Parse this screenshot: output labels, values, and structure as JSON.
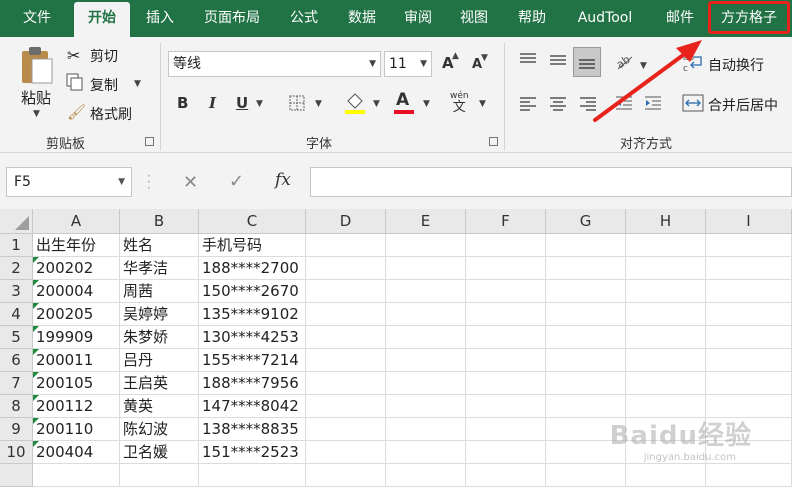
{
  "tabs": [
    "文件",
    "开始",
    "插入",
    "页面布局",
    "公式",
    "数据",
    "审阅",
    "视图",
    "帮助",
    "AudTool",
    "邮件",
    "方方格子"
  ],
  "active_tab": "开始",
  "clipboard": {
    "paste": "粘贴",
    "cut": "剪切",
    "copy": "复制",
    "format_painter": "格式刷",
    "group": "剪贴板"
  },
  "font": {
    "name": "等线",
    "size": "11",
    "bold": "B",
    "italic": "I",
    "underline": "U",
    "font_color": "A",
    "group": "字体",
    "fill_color": "#ffff00",
    "text_color": "#e81123",
    "grow": "A",
    "shrink": "A",
    "phonetic_top": "wén",
    "phonetic_bottom": "文"
  },
  "alignment": {
    "wrap": "自动换行",
    "merge": "合并后居中",
    "group": "对齐方式"
  },
  "formula": {
    "namebox": "F5",
    "fx": "fx",
    "value": ""
  },
  "columns": [
    "A",
    "B",
    "C",
    "D",
    "E",
    "F",
    "G",
    "H",
    "I"
  ],
  "rows": [
    {
      "num": "1",
      "a": "出生年份",
      "b": "姓名",
      "c": "手机号码",
      "flag": false
    },
    {
      "num": "2",
      "a": "200202",
      "b": "华孝洁",
      "c": "188****2700",
      "flag": true
    },
    {
      "num": "3",
      "a": "200004",
      "b": "周茜",
      "c": "150****2670",
      "flag": true
    },
    {
      "num": "4",
      "a": "200205",
      "b": "吴婷婷",
      "c": "135****9102",
      "flag": true
    },
    {
      "num": "5",
      "a": "199909",
      "b": "朱梦娇",
      "c": "130****4253",
      "flag": true
    },
    {
      "num": "6",
      "a": "200011",
      "b": "吕丹",
      "c": "155****7214",
      "flag": true
    },
    {
      "num": "7",
      "a": "200105",
      "b": "王启英",
      "c": "188****7956",
      "flag": true
    },
    {
      "num": "8",
      "a": "200112",
      "b": "黄英",
      "c": "147****8042",
      "flag": true
    },
    {
      "num": "9",
      "a": "200110",
      "b": "陈幻波",
      "c": "138****8835",
      "flag": true
    },
    {
      "num": "10",
      "a": "200404",
      "b": "卫名媛",
      "c": "151****2523",
      "flag": true
    }
  ],
  "watermark": "Baidu经验",
  "watermark_sub": "jingyan.baidu.com",
  "accent": "#217346",
  "highlight": "#e8231c"
}
